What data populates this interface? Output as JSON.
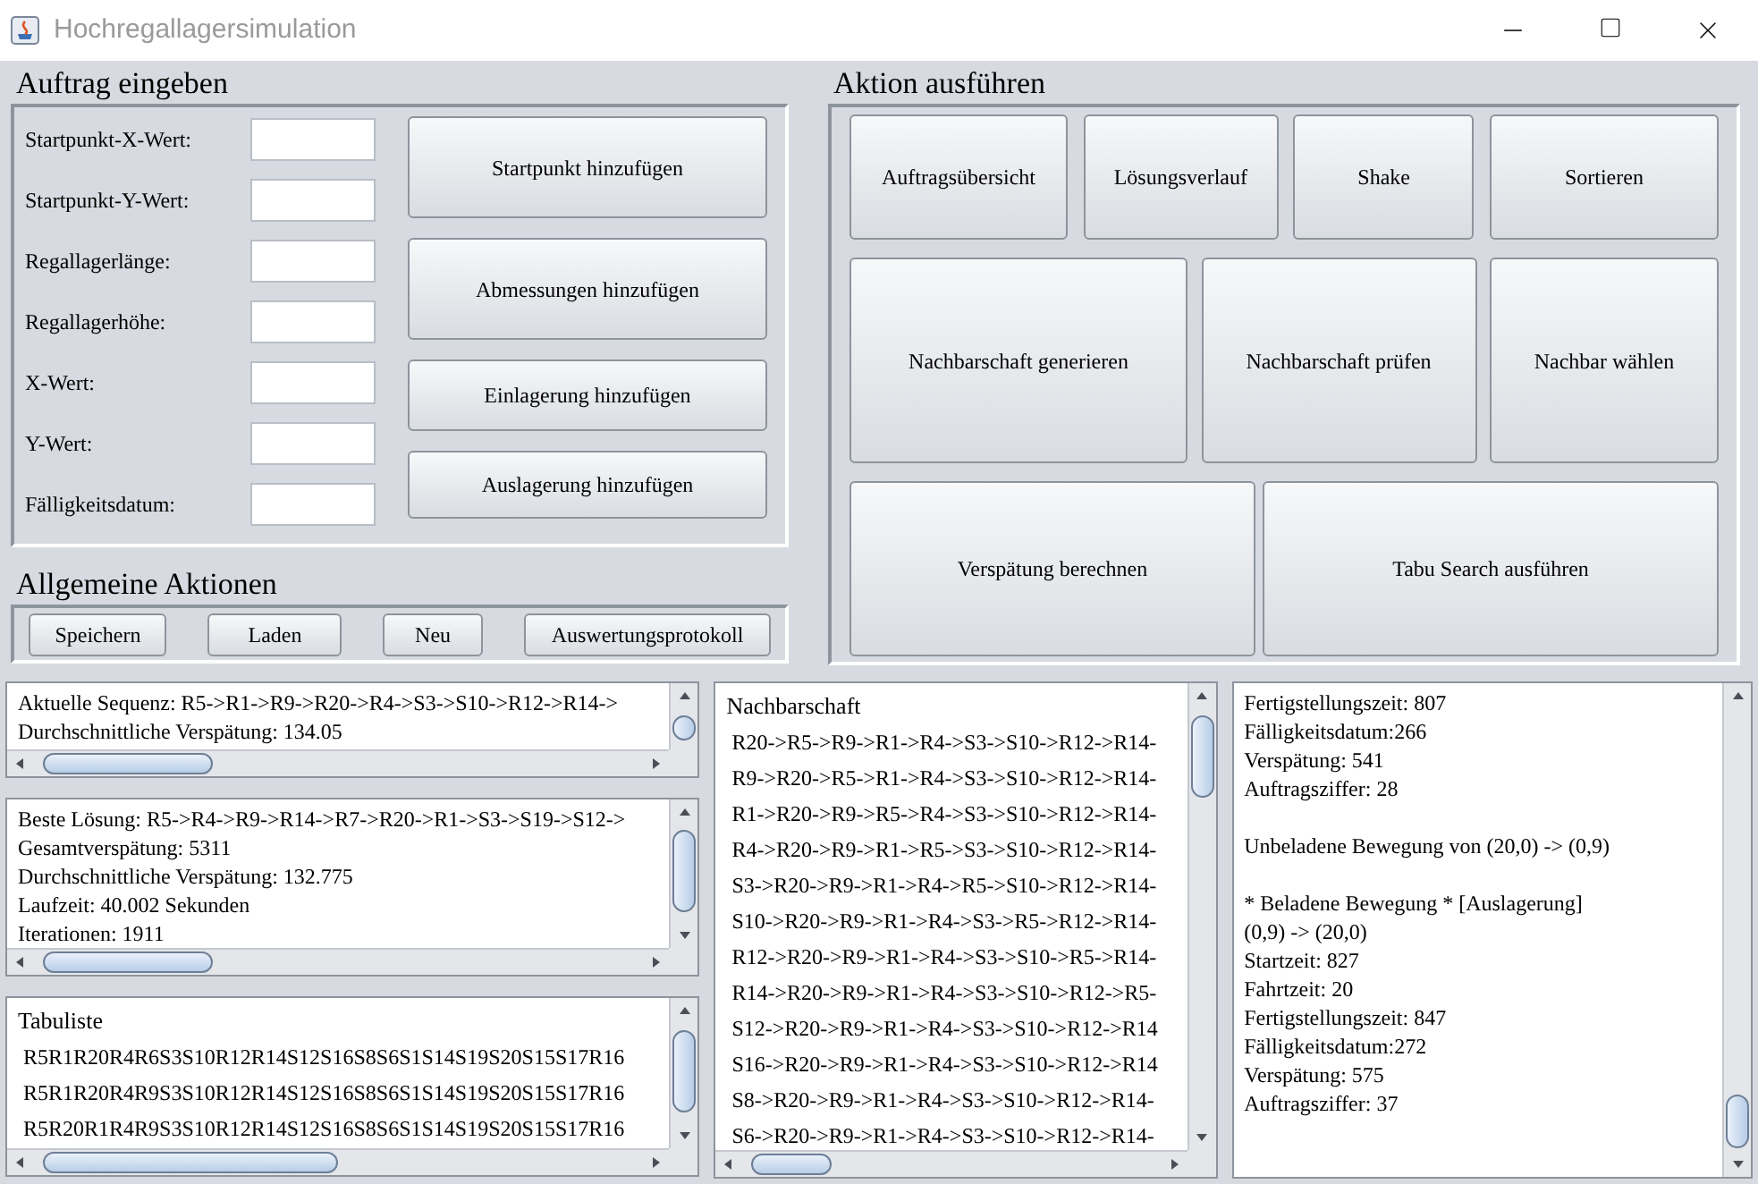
{
  "window": {
    "title": "Hochregallagersimulation"
  },
  "order_panel": {
    "title": "Auftrag eingeben",
    "fields": [
      {
        "label": "Startpunkt-X-Wert:"
      },
      {
        "label": "Startpunkt-Y-Wert:"
      },
      {
        "label": "Regallagerlänge:"
      },
      {
        "label": "Regallagerhöhe:"
      },
      {
        "label": "X-Wert:"
      },
      {
        "label": "Y-Wert:"
      },
      {
        "label": "Fälligkeitsdatum:"
      }
    ],
    "buttons": [
      "Startpunkt hinzufügen",
      "Abmessungen hinzufügen",
      "Einlagerung hinzufügen",
      "Auslagerung hinzufügen"
    ]
  },
  "general_panel": {
    "title": "Allgemeine Aktionen",
    "buttons": [
      "Speichern",
      "Laden",
      "Neu",
      "Auswertungsprotokoll"
    ]
  },
  "action_panel": {
    "title": "Aktion ausführen",
    "buttons": [
      "Auftragsübersicht",
      "Lösungsverlauf",
      "Shake",
      "Sortieren",
      "Nachbarschaft generieren",
      "Nachbarschaft prüfen",
      "Nachbar wählen",
      "Verspätung berechnen",
      "Tabu Search ausführen"
    ]
  },
  "current_sequence": {
    "lines": [
      "Aktuelle Sequenz: R5->R1->R9->R20->R4->S3->S10->R12->R14->",
      "Durchschnittliche Verspätung: 134.05"
    ]
  },
  "best_solution": {
    "lines": [
      "Beste Lösung: R5->R4->R9->R14->R7->R20->R1->S3->S19->S12->",
      "Gesamtverspätung: 5311",
      "Durchschnittliche Verspätung: 132.775",
      "Laufzeit: 40.002 Sekunden",
      "Iterationen: 1911"
    ]
  },
  "tabu_list": {
    "title": "Tabuliste",
    "items": [
      "R5R1R20R4R6S3S10R12R14S12S16S8S6S1S14S19S20S15S17R16",
      "R5R1R20R4R9S3S10R12R14S12S16S8S6S1S14S19S20S15S17R16",
      "R5R20R1R4R9S3S10R12R14S12S16S8S6S1S14S19S20S15S17R16"
    ]
  },
  "neighborhood": {
    "title": "Nachbarschaft",
    "items": [
      "R20->R5->R9->R1->R4->S3->S10->R12->R14-",
      "R9->R20->R5->R1->R4->S3->S10->R12->R14-",
      "R1->R20->R9->R5->R4->S3->S10->R12->R14-",
      "R4->R20->R9->R1->R5->S3->S10->R12->R14-",
      "S3->R20->R9->R1->R4->R5->S10->R12->R14-",
      "S10->R20->R9->R1->R4->S3->R5->R12->R14-",
      "R12->R20->R9->R1->R4->S3->S10->R5->R14-",
      "R14->R20->R9->R1->R4->S3->S10->R12->R5-",
      "S12->R20->R9->R1->R4->S3->S10->R12->R14",
      "S16->R20->R9->R1->R4->S3->S10->R12->R14",
      "S8->R20->R9->R1->R4->S3->S10->R12->R14-",
      "S6->R20->R9->R1->R4->S3->S10->R12->R14-"
    ]
  },
  "log": {
    "paragraphs": [
      [
        "Fertigstellungszeit: 807",
        "Fälligkeitsdatum:266",
        "Verspätung: 541",
        "Auftragsziffer: 28"
      ],
      [
        "Unbeladene Bewegung von (20,0) -> (0,9)"
      ],
      [
        "* Beladene Bewegung * [Auslagerung]",
        "(0,9) -> (20,0)",
        "Startzeit: 827",
        "Fahrtzeit: 20",
        "Fertigstellungszeit: 847",
        "Fälligkeitsdatum:272",
        "Verspätung: 575",
        "Auftragsziffer: 37"
      ]
    ]
  }
}
